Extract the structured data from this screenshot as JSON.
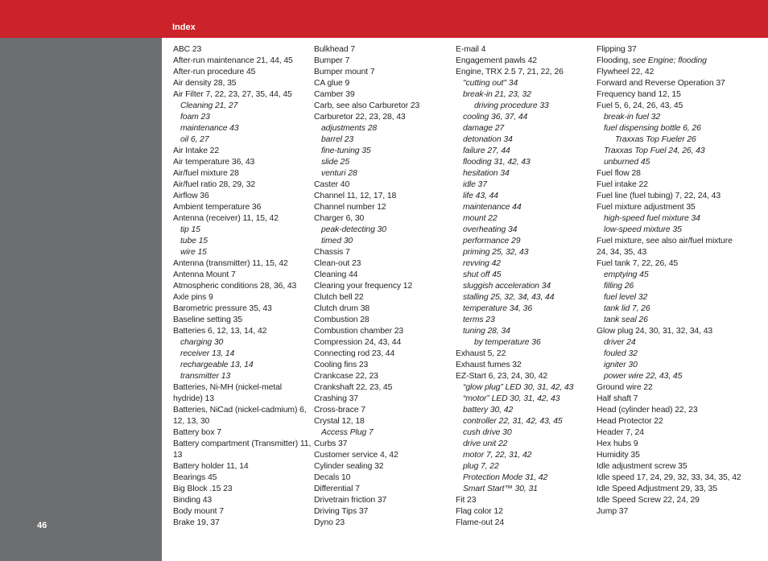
{
  "header": {
    "section_title": "Index"
  },
  "footer": {
    "page_number": "46"
  },
  "colors": {
    "accent": "#cc2229",
    "sidebar": "#6d6e70"
  },
  "columns": [
    {
      "entries": [
        {
          "text": "ABC 23",
          "level": 0
        },
        {
          "text": "After-run maintenance 21, 44, 45",
          "level": 0
        },
        {
          "text": "After-run procedure 45",
          "level": 0
        },
        {
          "text": "Air density 28, 35",
          "level": 0
        },
        {
          "text": "Air Filter 7, 22, 23, 27, 35, 44, 45",
          "level": 0
        },
        {
          "text": "Cleaning 21, 27",
          "level": 1
        },
        {
          "text": "foam 23",
          "level": 1
        },
        {
          "text": "maintenance 43",
          "level": 1
        },
        {
          "text": "oil 6, 27",
          "level": 1
        },
        {
          "text": "Air Intake 22",
          "level": 0
        },
        {
          "text": "Air temperature 36, 43",
          "level": 0
        },
        {
          "text": "Air/fuel mixture 28",
          "level": 0
        },
        {
          "text": "Air/fuel ratio 28, 29, 32",
          "level": 0
        },
        {
          "text": "Airflow 36",
          "level": 0
        },
        {
          "text": "Ambient temperature 36",
          "level": 0
        },
        {
          "text": "Antenna (receiver) 11, 15, 42",
          "level": 0
        },
        {
          "text": "tip 15",
          "level": 1
        },
        {
          "text": "tube 15",
          "level": 1
        },
        {
          "text": "wire 15",
          "level": 1
        },
        {
          "text": "Antenna (transmitter) 11, 15, 42",
          "level": 0
        },
        {
          "text": "Antenna Mount 7",
          "level": 0
        },
        {
          "text": "Atmospheric conditions 28, 36, 43",
          "level": 0
        },
        {
          "text": "Axle pins 9",
          "level": 0
        },
        {
          "text": "Barometric pressure 35, 43",
          "level": 0
        },
        {
          "text": "Baseline setting 35",
          "level": 0
        },
        {
          "text": "Batteries 6, 12, 13, 14, 42",
          "level": 0
        },
        {
          "text": "charging 30",
          "level": 1
        },
        {
          "text": "receiver 13, 14",
          "level": 1
        },
        {
          "text": "rechargeable 13, 14",
          "level": 1
        },
        {
          "text": "transmitter 13",
          "level": 1
        },
        {
          "text": "Batteries, Ni-MH (nickel-metal hydride) 13",
          "level": 0
        },
        {
          "text": "Batteries, NiCad (nickel-cadmium) 6, 12, 13, 30",
          "level": 0
        },
        {
          "text": "Battery box 7",
          "level": 0
        },
        {
          "text": "Battery compartment (Transmitter) 11, 13",
          "level": 0
        },
        {
          "text": "Battery holder 11, 14",
          "level": 0
        },
        {
          "text": "Bearings 45",
          "level": 0
        },
        {
          "text": "Big Block .15 23",
          "level": 0
        },
        {
          "text": "Binding 43",
          "level": 0
        },
        {
          "text": "Body mount 7",
          "level": 0
        },
        {
          "text": "Brake 19, 37",
          "level": 0
        }
      ]
    },
    {
      "entries": [
        {
          "text": "Bulkhead 7",
          "level": 0
        },
        {
          "text": "Bumper 7",
          "level": 0
        },
        {
          "text": "Bumper mount 7",
          "level": 0
        },
        {
          "text": "CA glue 9",
          "level": 0
        },
        {
          "text": "Camber 39",
          "level": 0
        },
        {
          "text": "Carb, see also Carburetor 23",
          "level": 0
        },
        {
          "text": "Carburetor 22, 23, 28, 43",
          "level": 0
        },
        {
          "text": "adjustments 28",
          "level": 1
        },
        {
          "text": "barrel 23",
          "level": 1
        },
        {
          "text": "fine-tuning 35",
          "level": 1
        },
        {
          "text": "slide 25",
          "level": 1
        },
        {
          "text": "venturi 28",
          "level": 1
        },
        {
          "text": "Caster 40",
          "level": 0
        },
        {
          "text": "Channel 11, 12, 17, 18",
          "level": 0
        },
        {
          "text": "Channel number 12",
          "level": 0
        },
        {
          "text": "Charger 6, 30",
          "level": 0
        },
        {
          "text": "peak-detecting 30",
          "level": 1
        },
        {
          "text": "timed 30",
          "level": 1
        },
        {
          "text": "Chassis 7",
          "level": 0
        },
        {
          "text": "Clean-out 23",
          "level": 0
        },
        {
          "text": "Cleaning 44",
          "level": 0
        },
        {
          "text": "Clearing your frequency 12",
          "level": 0
        },
        {
          "text": "Clutch bell 22",
          "level": 0
        },
        {
          "text": "Clutch drum 38",
          "level": 0
        },
        {
          "text": "Combustion 28",
          "level": 0
        },
        {
          "text": "Combustion chamber 23",
          "level": 0
        },
        {
          "text": "Compression 24, 43, 44",
          "level": 0
        },
        {
          "text": "Connecting rod 23, 44",
          "level": 0
        },
        {
          "text": "Cooling fins 23",
          "level": 0
        },
        {
          "text": "Crankcase 22, 23",
          "level": 0
        },
        {
          "text": "Crankshaft 22, 23, 45",
          "level": 0
        },
        {
          "text": "Crashing 37",
          "level": 0
        },
        {
          "text": "Cross-brace 7",
          "level": 0
        },
        {
          "text": "Crystal 12, 18",
          "level": 0
        },
        {
          "text": "Access Plug 7",
          "level": 1
        },
        {
          "text": "Curbs 37",
          "level": 0
        },
        {
          "text": "Customer service 4, 42",
          "level": 0
        },
        {
          "text": "Cylinder sealing 32",
          "level": 0
        },
        {
          "text": "Decals 10",
          "level": 0
        },
        {
          "text": "Differential 7",
          "level": 0
        },
        {
          "text": "Drivetrain friction 37",
          "level": 0
        },
        {
          "text": "Driving Tips 37",
          "level": 0
        },
        {
          "text": "Dyno 23",
          "level": 0
        }
      ]
    },
    {
      "entries": [
        {
          "text": "E-mail 4",
          "level": 0
        },
        {
          "text": "Engagement pawls 42",
          "level": 0
        },
        {
          "text": "Engine, TRX 2.5 7, 21, 22, 26",
          "level": 0
        },
        {
          "text": "\"cutting out\" 34",
          "level": 1
        },
        {
          "text": "break-in 21, 23, 32",
          "level": 1
        },
        {
          "text": "driving procedure 33",
          "level": 2
        },
        {
          "text": "cooling 36, 37, 44",
          "level": 1
        },
        {
          "text": "damage 27",
          "level": 1
        },
        {
          "text": "detonation 34",
          "level": 1
        },
        {
          "text": "failure 27, 44",
          "level": 1
        },
        {
          "text": "flooding 31, 42, 43",
          "level": 1
        },
        {
          "text": "hesitation 34",
          "level": 1
        },
        {
          "text": "idle 37",
          "level": 1
        },
        {
          "text": "life 43, 44",
          "level": 1
        },
        {
          "text": "maintenance 44",
          "level": 1
        },
        {
          "text": "mount 22",
          "level": 1
        },
        {
          "text": "overheating 34",
          "level": 1
        },
        {
          "text": "performance 29",
          "level": 1
        },
        {
          "text": "priming 25, 32, 43",
          "level": 1
        },
        {
          "text": "revving 42",
          "level": 1
        },
        {
          "text": "shut off 45",
          "level": 1
        },
        {
          "text": "sluggish acceleration 34",
          "level": 1
        },
        {
          "text": "stalling 25, 32, 34, 43, 44",
          "level": 1
        },
        {
          "text": "temperature 34, 36",
          "level": 1
        },
        {
          "text": "terms 23",
          "level": 1
        },
        {
          "text": "tuning 28, 34",
          "level": 1
        },
        {
          "text": "by temperature 36",
          "level": 2
        },
        {
          "text": "Exhaust 5, 22",
          "level": 0
        },
        {
          "text": "Exhaust fumes 32",
          "level": 0
        },
        {
          "text": "EZ-Start 6, 23, 24, 30, 42",
          "level": 0
        },
        {
          "text": "“glow plug” LED 30, 31, 42, 43",
          "level": 1
        },
        {
          "text": "“motor” LED 30, 31, 42, 43",
          "level": 1
        },
        {
          "text": "battery 30, 42",
          "level": 1
        },
        {
          "text": "controller 22, 31, 42, 43, 45",
          "level": 1
        },
        {
          "text": "cush drive 30",
          "level": 1
        },
        {
          "text": "drive unit 22",
          "level": 1
        },
        {
          "text": "motor 7, 22, 31, 42",
          "level": 1
        },
        {
          "text": "plug 7, 22",
          "level": 1
        },
        {
          "text": "Protection Mode 31, 42",
          "level": 1
        },
        {
          "text": "Smart Start™ 30, 31",
          "level": 1
        },
        {
          "text": "Fit 23",
          "level": 0
        },
        {
          "text": "Flag color 12",
          "level": 0
        },
        {
          "text": "Flame-out 24",
          "level": 0
        }
      ]
    },
    {
      "entries": [
        {
          "text": "Flipping 37",
          "level": 0
        },
        {
          "text": "Flooding,",
          "see": " see Engine; flooding",
          "level": 0
        },
        {
          "text": "Flywheel 22, 42",
          "level": 0
        },
        {
          "text": "Forward and Reverse Operation 37",
          "level": 0
        },
        {
          "text": "Frequency band 12, 15",
          "level": 0
        },
        {
          "text": "Fuel 5, 6, 24, 26, 43, 45",
          "level": 0
        },
        {
          "text": "break-in fuel 32",
          "level": 1
        },
        {
          "text": "fuel dispensing bottle 6, 26",
          "level": 1
        },
        {
          "text": "Traxxas Top Fueler 26",
          "level": 2
        },
        {
          "text": "Traxxas Top Fuel 24, 26, 43",
          "level": 1
        },
        {
          "text": "unburned 45",
          "level": 1
        },
        {
          "text": "Fuel flow 28",
          "level": 0
        },
        {
          "text": "Fuel intake 22",
          "level": 0
        },
        {
          "text": "Fuel line (fuel tubing) 7, 22, 24, 43",
          "level": 0
        },
        {
          "text": "Fuel mixture adjustment 35",
          "level": 0
        },
        {
          "text": "high-speed fuel mixture 34",
          "level": 1
        },
        {
          "text": "low-speed mixture 35",
          "level": 1
        },
        {
          "text": "Fuel mixture, see also air/fuel mixture 24, 34, 35, 43",
          "level": 0
        },
        {
          "text": "Fuel tank 7, 22, 26, 45",
          "level": 0
        },
        {
          "text": "emptying 45",
          "level": 1
        },
        {
          "text": "filling 26",
          "level": 1
        },
        {
          "text": "fuel level 32",
          "level": 1
        },
        {
          "text": "tank lid 7, 26",
          "level": 1
        },
        {
          "text": "tank seal 26",
          "level": 1
        },
        {
          "text": "Glow plug 24, 30, 31, 32, 34, 43",
          "level": 0
        },
        {
          "text": "driver 24",
          "level": 1
        },
        {
          "text": "fouled 32",
          "level": 1
        },
        {
          "text": "igniter 30",
          "level": 1
        },
        {
          "text": "power wire 22, 43, 45",
          "level": 1
        },
        {
          "text": "Ground wire 22",
          "level": 0
        },
        {
          "text": "Half shaft 7",
          "level": 0
        },
        {
          "text": "Head (cylinder head) 22, 23",
          "level": 0
        },
        {
          "text": "Head Protector 22",
          "level": 0
        },
        {
          "text": "Header 7, 24",
          "level": 0
        },
        {
          "text": "Hex hubs 9",
          "level": 0
        },
        {
          "text": "Humidity 35",
          "level": 0
        },
        {
          "text": "Idle adjustment screw 35",
          "level": 0
        },
        {
          "text": "Idle speed 17, 24, 29, 32, 33, 34, 35, 42",
          "level": 0
        },
        {
          "text": "Idle Speed Adjustment 29, 33, 35",
          "level": 0
        },
        {
          "text": "Idle Speed Screw 22, 24, 29",
          "level": 0
        },
        {
          "text": "Jump 37",
          "level": 0
        }
      ]
    }
  ]
}
